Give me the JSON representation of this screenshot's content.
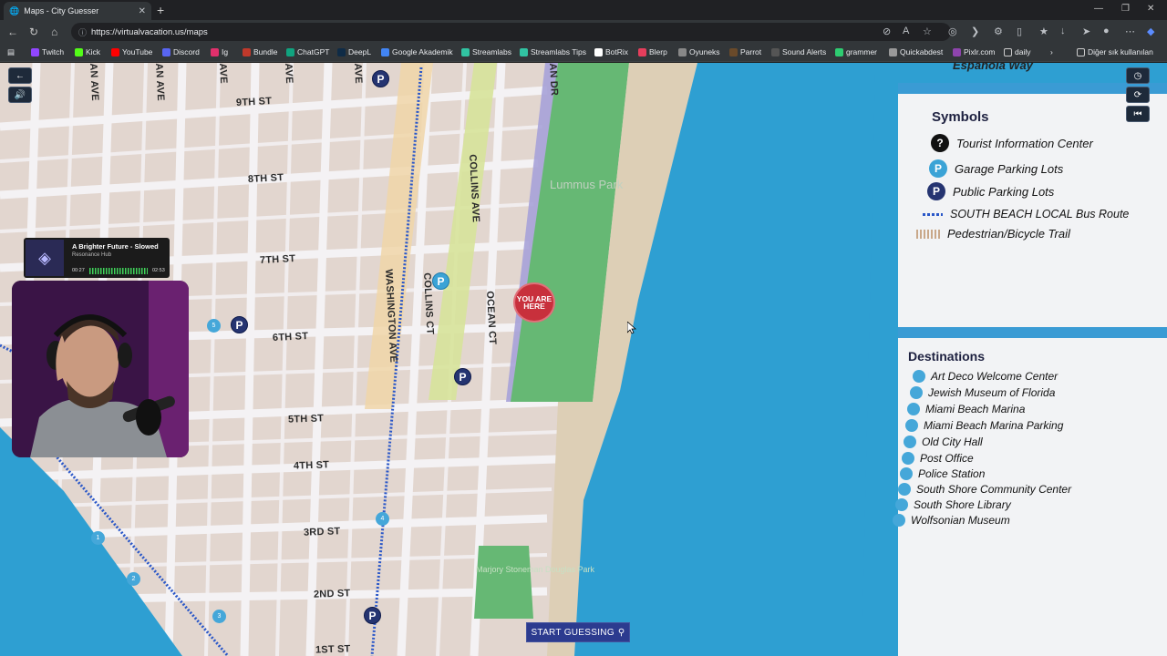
{
  "browser": {
    "tab_title": "Maps - City Guesser",
    "url": "https://virtualvacation.us/maps",
    "bookmarks": [
      "Twitch",
      "Kick",
      "YouTube",
      "Discord",
      "Ig",
      "Bundle",
      "ChatGPT",
      "DeepL",
      "Google Akademik",
      "Streamlabs",
      "Streamlabs Tips",
      "BotRix",
      "Blerp",
      "Oyuneks",
      "Parrot",
      "Sound Alerts",
      "grammer",
      "Quickabdest",
      "Pixlr.com",
      "daily"
    ],
    "other_bookmarks": "Diğer sık kullanılan"
  },
  "map": {
    "streets_h": [
      "9TH ST",
      "8TH ST",
      "7TH ST",
      "6TH ST",
      "5TH ST",
      "4TH ST",
      "3RD ST",
      "2ND ST",
      "1ST ST"
    ],
    "streets_v_top": [
      "AN AVE",
      "AN AVE",
      "AVE",
      "AVE",
      "AVE"
    ],
    "collins_ave": "COLLINS AVE",
    "washington_ave": "WASHINGTON AVE",
    "collins_ct": "COLLINS CT",
    "ocean_ct": "OCEAN CT",
    "ocean_dr": "AN DR",
    "park": "Lummus Park",
    "park2": "Marjory Stoneman Douglas Park",
    "you_are_here": "YOU ARE HERE",
    "parking_letter": "P",
    "numbered_markers": [
      "5",
      "4",
      "1",
      "2",
      "3"
    ]
  },
  "legend": {
    "top_text": "Española Way",
    "symbols_title": "Symbols",
    "symbols": [
      {
        "icon": "question-icon",
        "label": "Tourist Information Center",
        "color": "#111111",
        "glyph": "?"
      },
      {
        "icon": "garage-parking-icon",
        "label": "Garage Parking Lots",
        "color": "#3ba3d6",
        "glyph": "P"
      },
      {
        "icon": "public-parking-icon",
        "label": "Public Parking Lots",
        "color": "#253471",
        "glyph": "P"
      },
      {
        "icon": "bus-route-icon",
        "label": "SOUTH BEACH LOCAL Bus Route",
        "color": "#2a57c8",
        "glyph": ""
      },
      {
        "icon": "trail-icon",
        "label": "Pedestrian/Bicycle Trail",
        "color": "#c9a88a",
        "glyph": ""
      }
    ],
    "destinations_title": "Destinations",
    "destinations": [
      "Art Deco Welcome Center",
      "Jewish Museum of Florida",
      "Miami Beach Marina",
      "Miami Beach Marina Parking",
      "Old City Hall",
      "Post Office",
      "Police Station",
      "South Shore Community Center",
      "South Shore Library",
      "Wolfsonian Museum"
    ]
  },
  "music_widget": {
    "title": "A Brighter Future - Slowed",
    "artist": "Resonance Hub",
    "elapsed": "00:27",
    "duration": "02:53"
  },
  "start_button": "START GUESSING"
}
